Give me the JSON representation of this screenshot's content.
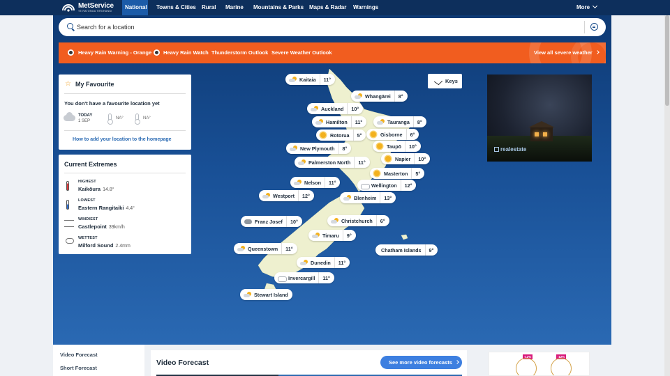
{
  "brand": {
    "name": "MetService",
    "subtitle": "TE RATONGA TIROHANGI"
  },
  "nav": {
    "items": [
      "National",
      "Towns & Cities",
      "Rural",
      "Marine",
      "Mountains & Parks",
      "Maps & Radar",
      "Warnings"
    ],
    "active": "National",
    "more": "More"
  },
  "search": {
    "placeholder": "Search for a location"
  },
  "warnings": {
    "items": [
      "Heavy Rain Warning - Orange",
      "Heavy Rain Watch",
      "Thunderstorm Outlook",
      "Severe Weather Outlook"
    ],
    "view_all": "View all severe weather"
  },
  "favourite": {
    "title": "My Favourite",
    "empty": "You don't have a favourite location yet",
    "today_label": "TODAY",
    "today_date": "1 SEP",
    "high": "NA°",
    "low": "NA°",
    "howto": "How to add your location to the homepage"
  },
  "extremes": {
    "title": "Current Extremes",
    "items": [
      {
        "label": "HIGHEST",
        "place": "Kaikōura",
        "value": "14.8°"
      },
      {
        "label": "LOWEST",
        "place": "Eastern Rangitaiki",
        "value": "4.4°"
      },
      {
        "label": "WINDIEST",
        "place": "Castlepoint",
        "value": "39km/h"
      },
      {
        "label": "WETTEST",
        "place": "Milford Sound",
        "value": "2.4mm"
      }
    ]
  },
  "map": {
    "keys_label": "Keys",
    "icon_colors": {
      "sun": "#f3b11e",
      "cloud": "#d5d9de"
    },
    "locations": [
      {
        "name": "Kaitaia",
        "temp": "11°",
        "icon": "partly"
      },
      {
        "name": "Whangārei",
        "temp": "8°",
        "icon": "partly"
      },
      {
        "name": "Auckland",
        "temp": "10°",
        "icon": "partly"
      },
      {
        "name": "Hamilton",
        "temp": "11°",
        "icon": "partly"
      },
      {
        "name": "Tauranga",
        "temp": "8°",
        "icon": "partly"
      },
      {
        "name": "Rotorua",
        "temp": "5°",
        "icon": "sunny"
      },
      {
        "name": "Gisborne",
        "temp": "6°",
        "icon": "sunny"
      },
      {
        "name": "New Plymouth",
        "temp": "8°",
        "icon": "partly"
      },
      {
        "name": "Taupō",
        "temp": "10°",
        "icon": "sunny"
      },
      {
        "name": "Palmerston North",
        "temp": "11°",
        "icon": "partly"
      },
      {
        "name": "Napier",
        "temp": "10°",
        "icon": "sunny"
      },
      {
        "name": "Masterton",
        "temp": "5°",
        "icon": "sunny"
      },
      {
        "name": "Nelson",
        "temp": "11°",
        "icon": "partly"
      },
      {
        "name": "Wellington",
        "temp": "12°",
        "icon": "cloudy"
      },
      {
        "name": "Westport",
        "temp": "12°",
        "icon": "partly"
      },
      {
        "name": "Blenheim",
        "temp": "13°",
        "icon": "partly"
      },
      {
        "name": "Franz Josef",
        "temp": "10°",
        "icon": "dark"
      },
      {
        "name": "Christchurch",
        "temp": "6°",
        "icon": "partly"
      },
      {
        "name": "Timaru",
        "temp": "9°",
        "icon": "partly"
      },
      {
        "name": "Chatham Islands",
        "temp": "9°",
        "icon": "none"
      },
      {
        "name": "Queenstown",
        "temp": "11°",
        "icon": "partly"
      },
      {
        "name": "Dunedin",
        "temp": "11°",
        "icon": "partly"
      },
      {
        "name": "Invercargill",
        "temp": "11°",
        "icon": "cloudy"
      },
      {
        "name": "Stewart Island",
        "temp": "",
        "icon": "partly"
      }
    ]
  },
  "ad": {
    "brand": "realestate"
  },
  "bottom": {
    "side_items": [
      "Video Forecast",
      "Short Forecast"
    ],
    "video_title": "Video Forecast",
    "video_button": "See more video forecasts",
    "ad_badges": [
      "-12%",
      "-12%"
    ]
  },
  "colors": {
    "nav": "#0d2f5c",
    "nav_active": "#1b5ba8",
    "warning": "#f15d1f",
    "accent_blue": "#3d7fe0"
  }
}
